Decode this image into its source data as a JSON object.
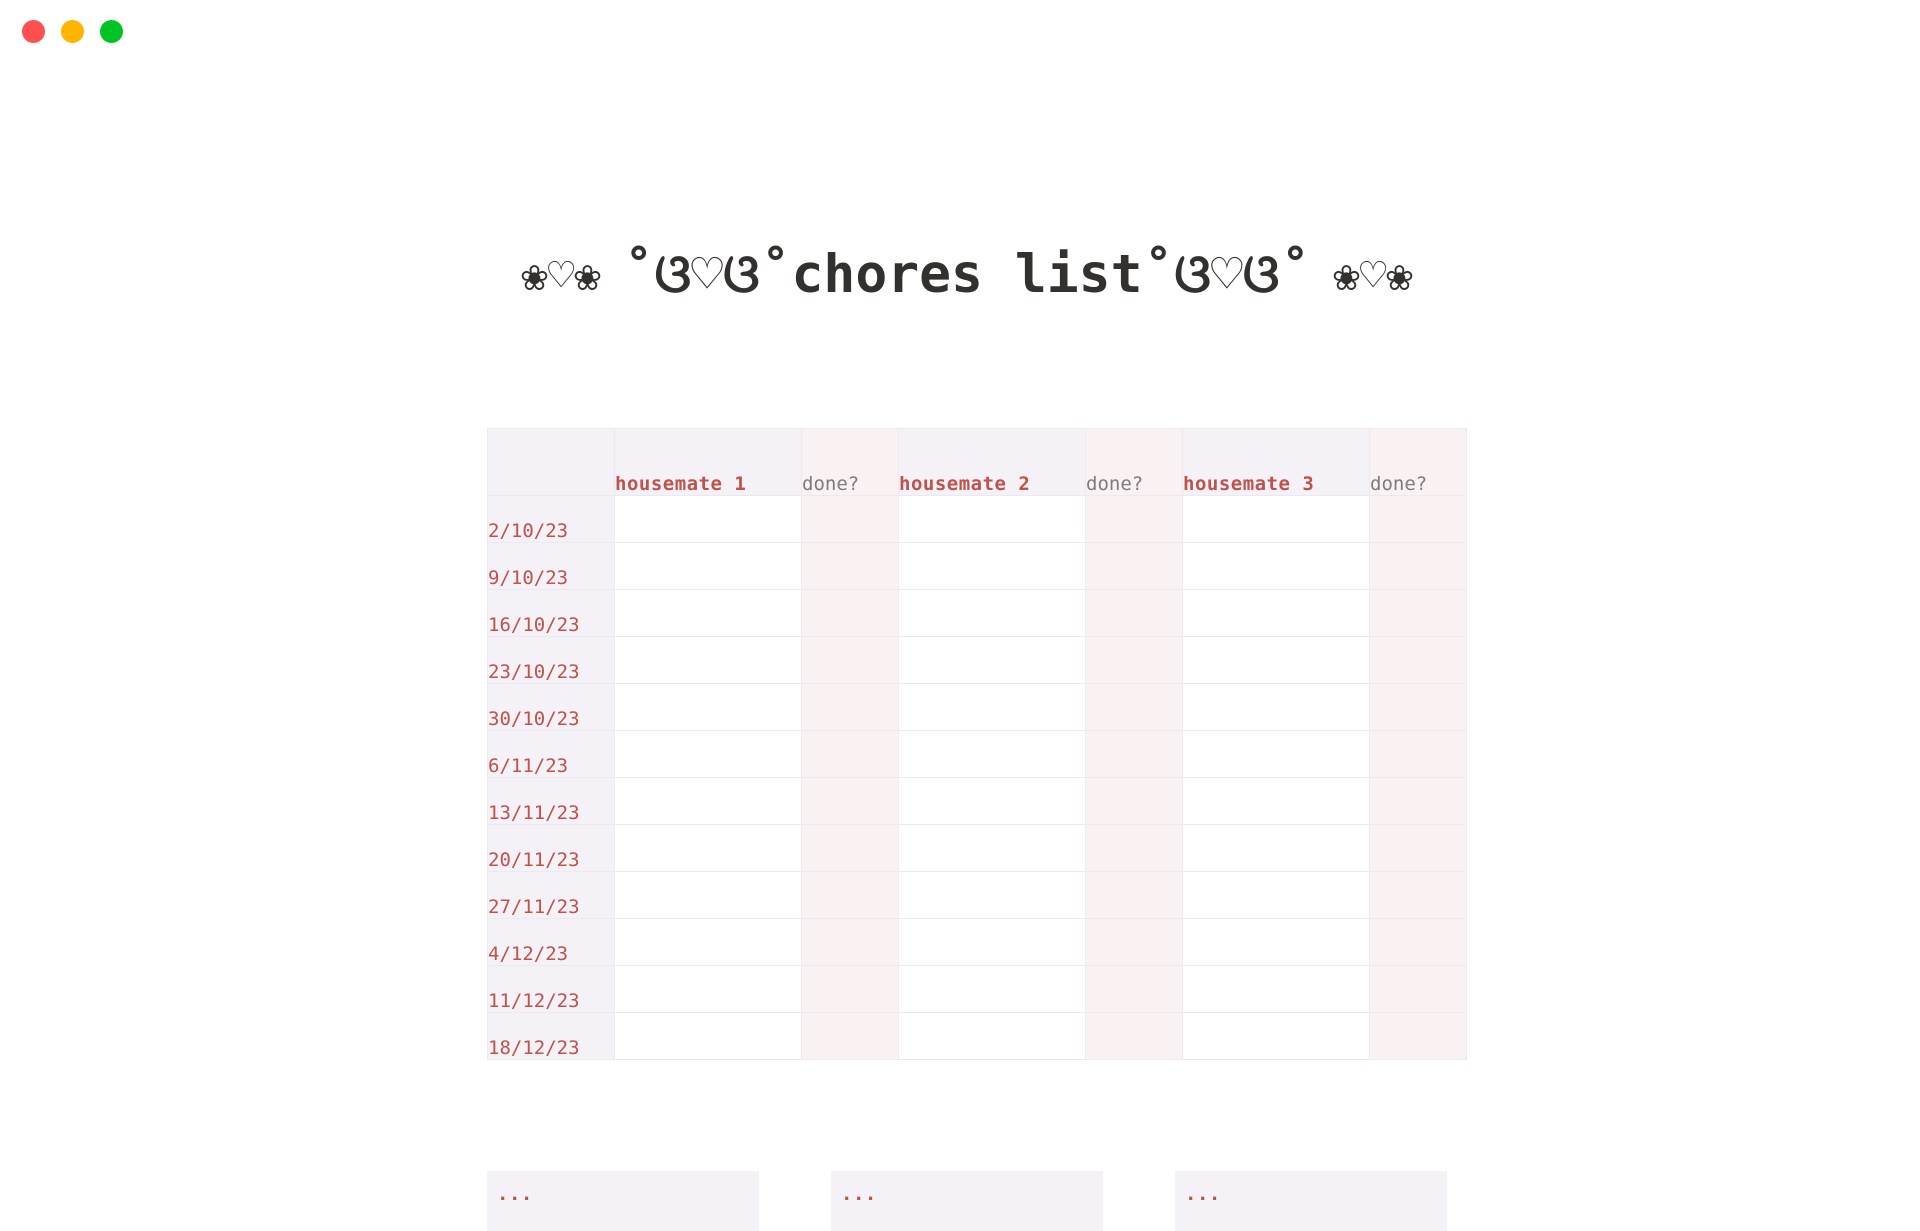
{
  "window": {
    "controls": [
      {
        "name": "close",
        "color": "#ff4f4f"
      },
      {
        "name": "minimize",
        "color": "#ffb400"
      },
      {
        "name": "maximize",
        "color": "#00c423"
      }
    ]
  },
  "document": {
    "title_left_deco": "❀♡❀",
    "title_inner_left_deco": "˚ଓ♡ଓ˚",
    "title_text": "chores list",
    "title_inner_right_deco": "˚ଓ♡ଓ˚",
    "title_right_deco": "❀♡❀",
    "title_full": "❀♡❀ ˚ଓ♡ଓ˚chores list˚ଓ♡ଓ˚ ❀♡❀"
  },
  "table": {
    "headers": {
      "date_col": "",
      "housemate_1": "housemate 1",
      "done_1": "done?",
      "housemate_2": "housemate 2",
      "done_2": "done?",
      "housemate_3": "housemate 3",
      "done_3": "done?"
    },
    "rows": [
      {
        "date": "2/10/23",
        "chore_1": "",
        "done_1": "",
        "chore_2": "",
        "done_2": "",
        "chore_3": "",
        "done_3": ""
      },
      {
        "date": "9/10/23",
        "chore_1": "",
        "done_1": "",
        "chore_2": "",
        "done_2": "",
        "chore_3": "",
        "done_3": ""
      },
      {
        "date": "16/10/23",
        "chore_1": "",
        "done_1": "",
        "chore_2": "",
        "done_2": "",
        "chore_3": "",
        "done_3": ""
      },
      {
        "date": "23/10/23",
        "chore_1": "",
        "done_1": "",
        "chore_2": "",
        "done_2": "",
        "chore_3": "",
        "done_3": ""
      },
      {
        "date": "30/10/23",
        "chore_1": "",
        "done_1": "",
        "chore_2": "",
        "done_2": "",
        "chore_3": "",
        "done_3": ""
      },
      {
        "date": "6/11/23",
        "chore_1": "",
        "done_1": "",
        "chore_2": "",
        "done_2": "",
        "chore_3": "",
        "done_3": ""
      },
      {
        "date": "13/11/23",
        "chore_1": "",
        "done_1": "",
        "chore_2": "",
        "done_2": "",
        "chore_3": "",
        "done_3": ""
      },
      {
        "date": "20/11/23",
        "chore_1": "",
        "done_1": "",
        "chore_2": "",
        "done_2": "",
        "chore_3": "",
        "done_3": ""
      },
      {
        "date": "27/11/23",
        "chore_1": "",
        "done_1": "",
        "chore_2": "",
        "done_2": "",
        "chore_3": "",
        "done_3": ""
      },
      {
        "date": "4/12/23",
        "chore_1": "",
        "done_1": "",
        "chore_2": "",
        "done_2": "",
        "chore_3": "",
        "done_3": ""
      },
      {
        "date": "11/12/23",
        "chore_1": "",
        "done_1": "",
        "chore_2": "",
        "done_2": "",
        "chore_3": "",
        "done_3": ""
      },
      {
        "date": "18/12/23",
        "chore_1": "",
        "done_1": "",
        "chore_2": "",
        "done_2": "",
        "chore_3": "",
        "done_3": ""
      }
    ]
  },
  "notes": {
    "box_1_title": "...",
    "box_2_title": "...",
    "box_3_title": "..."
  },
  "colors": {
    "accent_red": "#c0514b",
    "title_dark": "#33312e",
    "header_lavender": "#f4f2f7",
    "done_pink": "#faf1f2",
    "border": "#eceaf0",
    "muted_grey": "#7c7c7c",
    "page_background": "#ffffff"
  }
}
